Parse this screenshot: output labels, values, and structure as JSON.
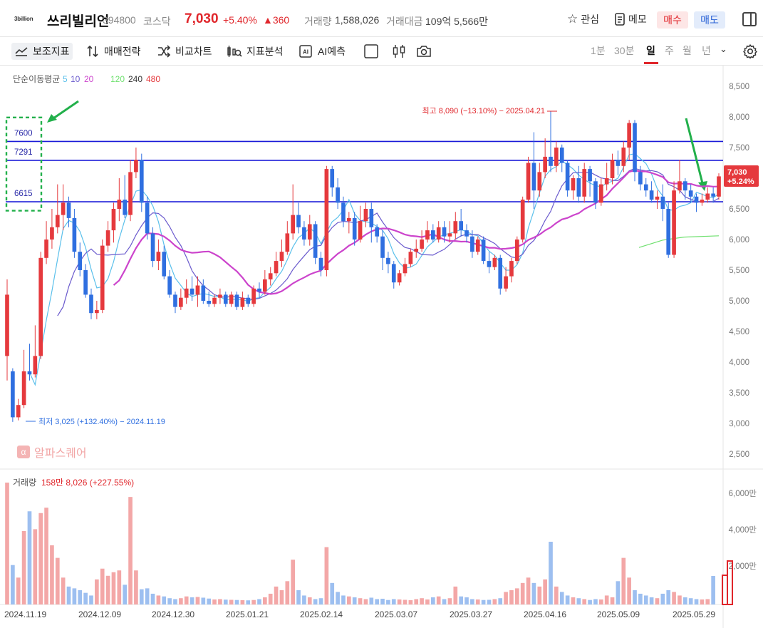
{
  "header": {
    "logo_text": "3billion",
    "name": "쓰리빌리언",
    "code": "394800",
    "market": "코스닥",
    "price": "7,030",
    "change_pct": "+5.40%",
    "change_abs": "▲360",
    "volume_label": "거래량",
    "volume_value": "1,588,026",
    "amount_label": "거래대금",
    "amount_value": "109억 5,566만",
    "watch_label": "관심",
    "memo_label": "메모",
    "buy_label": "매수",
    "sell_label": "매도"
  },
  "toolbar": {
    "items": [
      "보조지표",
      "매매전략",
      "비교차트",
      "지표분석",
      "AI예측"
    ],
    "periods": [
      "1분",
      "30분",
      "일",
      "주",
      "월",
      "년"
    ],
    "selected_period": "일"
  },
  "colors": {
    "up": "#e5393d",
    "down": "#2f6fe0",
    "ma5": "#5bc0eb",
    "ma10": "#6a5acd",
    "ma20": "#cc44cc",
    "ma120": "#6ee06e",
    "hline": "#1a1ad8"
  },
  "watermark": "알파스퀘어",
  "chart_data": {
    "type": "candlestick",
    "ma_legend": {
      "title": "단순이동평균",
      "periods": [
        "5",
        "10",
        "20",
        "120",
        "240",
        "480"
      ]
    },
    "y_ticks": [
      "8,500",
      "8,000",
      "7,500",
      "7,000",
      "6,500",
      "6,000",
      "5,500",
      "5,000",
      "4,500",
      "4,000",
      "3,500",
      "3,000",
      "2,500"
    ],
    "ylim": [
      2300,
      8800
    ],
    "x_ticks": [
      "2024.11.19",
      "2024.12.09",
      "2024.12.30",
      "2025.01.21",
      "2025.02.14",
      "2025.03.07",
      "2025.03.27",
      "2025.04.16",
      "2025.05.09",
      "2025.05.29"
    ],
    "hlines": [
      {
        "label": "7600",
        "value": 7600
      },
      {
        "label": "7291",
        "value": 7291
      },
      {
        "label": "6615",
        "value": 6615
      }
    ],
    "high_annotation": "최고 8,090 (−13.10%) − 2025.04.21",
    "low_annotation": "최저 3,025 (+132.40%) − 2024.11.19",
    "last_price_tag": "7,030",
    "last_pct_tag": "+5.24%",
    "volume_label": "거래량",
    "volume_info": "158만 8,026 (+227.55%)",
    "volume_ticks": [
      "6,000만",
      "4,000만",
      "2,000만"
    ],
    "volume_max": 7000,
    "candles": [
      [
        4100,
        5100,
        3700,
        5350
      ],
      [
        3850,
        3100,
        3025,
        3900
      ],
      [
        3100,
        3300,
        3050,
        3400
      ],
      [
        3300,
        3850,
        3250,
        4200
      ],
      [
        3850,
        3800,
        3700,
        4300
      ],
      [
        3800,
        4100,
        3750,
        4600
      ],
      [
        4100,
        5700,
        4050,
        5800
      ],
      [
        5700,
        6000,
        5600,
        6300
      ],
      [
        6000,
        6200,
        5850,
        6500
      ],
      [
        6200,
        6400,
        6100,
        6900
      ],
      [
        6400,
        6600,
        6150,
        6900
      ],
      [
        6600,
        6350,
        6200,
        6700
      ],
      [
        6350,
        5800,
        5700,
        6500
      ],
      [
        5800,
        5500,
        5400,
        5950
      ],
      [
        5500,
        5100,
        5050,
        5600
      ],
      [
        5100,
        4800,
        4700,
        5200
      ],
      [
        4800,
        4850,
        4700,
        5000
      ],
      [
        4850,
        5900,
        4800,
        6000
      ],
      [
        5900,
        6150,
        5800,
        6300
      ],
      [
        6150,
        6500,
        5950,
        6600
      ],
      [
        6500,
        6650,
        6300,
        7000
      ],
      [
        6650,
        6400,
        6350,
        7050
      ],
      [
        6400,
        7100,
        6300,
        7300
      ],
      [
        7100,
        7300,
        7000,
        7500
      ],
      [
        7300,
        6600,
        6450,
        7400
      ],
      [
        6600,
        6100,
        6000,
        6700
      ],
      [
        6100,
        5650,
        5550,
        6200
      ],
      [
        5650,
        5800,
        5500,
        6000
      ],
      [
        5800,
        5400,
        5350,
        5900
      ],
      [
        5400,
        5100,
        5050,
        5500
      ],
      [
        5100,
        4900,
        4800,
        5150
      ],
      [
        4900,
        5050,
        4850,
        5200
      ],
      [
        5050,
        5200,
        4950,
        5350
      ],
      [
        5200,
        5100,
        5000,
        5400
      ],
      [
        5100,
        5250,
        4900,
        5400
      ],
      [
        5250,
        5000,
        4950,
        5350
      ],
      [
        5000,
        4950,
        4900,
        5150
      ],
      [
        4950,
        5050,
        4900,
        5100
      ],
      [
        5050,
        5100,
        4950,
        5200
      ],
      [
        5100,
        4950,
        4900,
        5150
      ],
      [
        4950,
        5100,
        4900,
        5150
      ],
      [
        5100,
        4900,
        4850,
        5150
      ],
      [
        4900,
        5050,
        4850,
        5150
      ],
      [
        5050,
        4950,
        4900,
        5100
      ],
      [
        4950,
        5200,
        4900,
        5250
      ],
      [
        5200,
        5150,
        5050,
        5300
      ],
      [
        5150,
        5350,
        5100,
        5500
      ],
      [
        5350,
        5450,
        5250,
        5550
      ],
      [
        5450,
        5650,
        5400,
        5800
      ],
      [
        5650,
        5800,
        5550,
        6000
      ],
      [
        5800,
        6100,
        5750,
        6300
      ],
      [
        6100,
        6400,
        6000,
        6900
      ],
      [
        6400,
        6200,
        6100,
        6600
      ],
      [
        6200,
        6000,
        5900,
        6300
      ],
      [
        6000,
        6250,
        5900,
        6400
      ],
      [
        6250,
        5700,
        5600,
        6300
      ],
      [
        5700,
        5500,
        5400,
        5800
      ],
      [
        5500,
        7150,
        5400,
        7200
      ],
      [
        7150,
        6850,
        6700,
        7200
      ],
      [
        6850,
        6600,
        6500,
        7000
      ],
      [
        6600,
        6300,
        6200,
        6700
      ],
      [
        6300,
        6350,
        6100,
        6450
      ],
      [
        6350,
        6000,
        5900,
        6450
      ],
      [
        6000,
        6300,
        5950,
        6550
      ],
      [
        6300,
        6500,
        6200,
        6600
      ],
      [
        6500,
        6200,
        5950,
        6600
      ],
      [
        6200,
        6050,
        5950,
        6250
      ],
      [
        6050,
        5700,
        5500,
        6150
      ],
      [
        5700,
        5600,
        5450,
        5800
      ],
      [
        5600,
        5300,
        5200,
        5650
      ],
      [
        5300,
        5450,
        5250,
        5500
      ],
      [
        5450,
        5600,
        5400,
        5700
      ],
      [
        5600,
        5800,
        5550,
        5850
      ],
      [
        5800,
        5850,
        5700,
        6000
      ],
      [
        5850,
        6000,
        5800,
        6150
      ],
      [
        6000,
        6150,
        5950,
        6300
      ],
      [
        6150,
        6000,
        5950,
        6250
      ],
      [
        6000,
        6200,
        5950,
        6300
      ],
      [
        6200,
        6050,
        5950,
        6300
      ],
      [
        6050,
        6100,
        5950,
        6300
      ],
      [
        6100,
        6300,
        6000,
        6450
      ],
      [
        6300,
        6150,
        6050,
        6500
      ],
      [
        6150,
        6050,
        5950,
        6250
      ],
      [
        6050,
        5800,
        5700,
        6150
      ],
      [
        5800,
        6000,
        5750,
        6050
      ],
      [
        6000,
        5650,
        5600,
        6050
      ],
      [
        5650,
        5550,
        5450,
        5800
      ],
      [
        5550,
        5700,
        5500,
        5750
      ],
      [
        5700,
        5200,
        5100,
        5750
      ],
      [
        5200,
        5400,
        5150,
        5550
      ],
      [
        5400,
        5650,
        5300,
        5700
      ],
      [
        5650,
        6000,
        5600,
        6050
      ],
      [
        6000,
        6650,
        5950,
        6700
      ],
      [
        6650,
        7250,
        6600,
        7350
      ],
      [
        7250,
        6800,
        6500,
        7750
      ],
      [
        6800,
        7100,
        6700,
        7250
      ],
      [
        7100,
        7350,
        7000,
        7650
      ],
      [
        7350,
        7200,
        7100,
        8090
      ],
      [
        7200,
        7500,
        7100,
        7600
      ],
      [
        7500,
        7250,
        7100,
        7550
      ],
      [
        7250,
        6800,
        6700,
        7300
      ],
      [
        6800,
        7000,
        6650,
        7050
      ],
      [
        7000,
        6700,
        6600,
        7200
      ],
      [
        6700,
        7150,
        6600,
        7250
      ],
      [
        7150,
        6950,
        6700,
        7200
      ],
      [
        6950,
        6600,
        6500,
        7000
      ],
      [
        6600,
        6900,
        6550,
        7000
      ],
      [
        6900,
        7000,
        6800,
        7250
      ],
      [
        7000,
        7300,
        6900,
        7400
      ],
      [
        7300,
        7200,
        7050,
        7450
      ],
      [
        7200,
        7500,
        7100,
        7600
      ],
      [
        7500,
        7900,
        7300,
        7950
      ],
      [
        7900,
        7100,
        6950,
        7950
      ],
      [
        7100,
        6900,
        6800,
        7200
      ],
      [
        6900,
        6800,
        6700,
        7000
      ],
      [
        6800,
        6650,
        6600,
        6950
      ],
      [
        6650,
        6700,
        6500,
        6800
      ],
      [
        6700,
        6500,
        6300,
        6900
      ],
      [
        6500,
        5750,
        5700,
        6600
      ],
      [
        5750,
        6800,
        5700,
        6950
      ],
      [
        6800,
        6950,
        6750,
        7300
      ],
      [
        6950,
        6800,
        6650,
        7000
      ],
      [
        6800,
        6700,
        6600,
        6900
      ],
      [
        6700,
        6600,
        6450,
        6750
      ],
      [
        6600,
        6650,
        6550,
        6750
      ],
      [
        6650,
        6750,
        6600,
        6850
      ],
      [
        6750,
        6700,
        6600,
        6850
      ],
      [
        6700,
        7030,
        6650,
        7080
      ]
    ],
    "volumes": [
      6800,
      2200,
      1500,
      4100,
      5200,
      4200,
      5100,
      5400,
      3300,
      2600,
      1500,
      1000,
      900,
      800,
      650,
      500,
      1400,
      2000,
      1600,
      1800,
      1900,
      1100,
      6000,
      1900,
      850,
      900,
      600,
      500,
      450,
      350,
      300,
      350,
      450,
      400,
      420,
      380,
      330,
      280,
      300,
      270,
      260,
      250,
      240,
      230,
      250,
      300,
      400,
      600,
      1000,
      800,
      1300,
      2500,
      800,
      500,
      400,
      300,
      350,
      3200,
      1200,
      700,
      500,
      450,
      400,
      350,
      300,
      380,
      300,
      320,
      250,
      300,
      280,
      260,
      240,
      300,
      350,
      280,
      400,
      450,
      300,
      350,
      1000,
      450,
      400,
      300,
      280,
      250,
      260,
      300,
      350,
      700,
      800,
      900,
      1200,
      1500,
      1200,
      1000,
      1400,
      3500,
      1000,
      700,
      500,
      400,
      350,
      300,
      250,
      300,
      280,
      500,
      400,
      1300,
      2600,
      1500,
      800,
      600,
      500,
      400,
      350,
      600,
      800,
      700,
      500,
      400,
      350,
      300,
      280,
      300,
      1590
    ]
  }
}
